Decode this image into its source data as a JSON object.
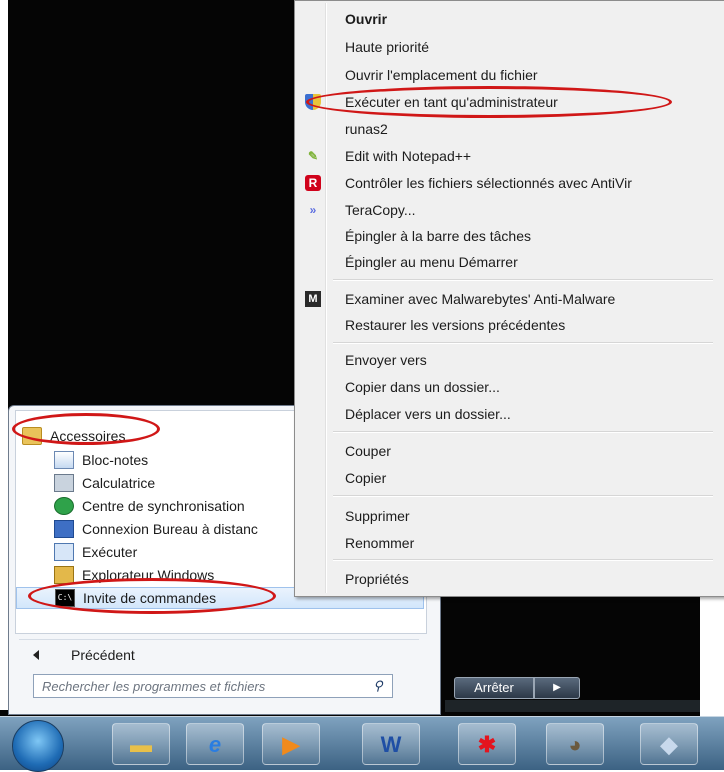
{
  "context_menu": {
    "items": [
      {
        "label": "Ouvrir",
        "bold": true,
        "icon": null
      },
      {
        "label": "Haute priorité",
        "icon": null
      },
      {
        "label": "Ouvrir l'emplacement du fichier",
        "icon": null
      },
      {
        "label": "Exécuter en tant qu'administrateur",
        "icon": "shield-icon"
      },
      {
        "label": "runas2",
        "icon": null
      },
      {
        "label": "Edit with Notepad++",
        "icon": "notepadpp-icon"
      },
      {
        "label": "Contrôler les fichiers sélectionnés avec AntiVir",
        "icon": "antivir-icon"
      },
      {
        "label": "TeraCopy...",
        "icon": "teracopy-icon"
      },
      {
        "label": "Épingler à la barre des tâches",
        "icon": null
      },
      {
        "label": "Épingler au menu Démarrer",
        "icon": null
      },
      {
        "label": "Examiner avec Malwarebytes' Anti-Malware",
        "icon": "malwarebytes-icon"
      },
      {
        "label": "Restaurer les versions précédentes",
        "icon": null
      },
      {
        "label": "Envoyer vers",
        "icon": null
      },
      {
        "label": "Copier dans un dossier...",
        "icon": null
      },
      {
        "label": "Déplacer vers un dossier...",
        "icon": null
      },
      {
        "label": "Couper",
        "icon": null
      },
      {
        "label": "Copier",
        "icon": null
      },
      {
        "label": "Supprimer",
        "icon": null
      },
      {
        "label": "Renommer",
        "icon": null
      },
      {
        "label": "Propriétés",
        "icon": null
      }
    ]
  },
  "start_menu": {
    "programs": [
      {
        "label": "Accessoires",
        "icon": "folder-icon"
      },
      {
        "label": "Bloc-notes",
        "icon": "notepad-icon"
      },
      {
        "label": "Calculatrice",
        "icon": "calculator-icon"
      },
      {
        "label": "Centre de synchronisation",
        "icon": "sync-center-icon"
      },
      {
        "label": "Connexion Bureau à distanc",
        "icon": "remote-desktop-icon"
      },
      {
        "label": "Exécuter",
        "icon": "run-icon"
      },
      {
        "label": "Explorateur Windows",
        "icon": "explorer-icon"
      },
      {
        "label": "Invite de commandes",
        "icon": "cmd-icon",
        "selected": true
      }
    ],
    "back_label": "Précédent",
    "search_placeholder": "Rechercher les programmes et fichiers",
    "shutdown_label": "Arrêter",
    "shutdown_arrow": "▶"
  },
  "taskbar": {
    "items": [
      "start-orb-icon",
      "folder-icon",
      "internet-explorer-icon",
      "media-player-icon",
      "word-icon",
      "red-splash-icon",
      "gimp-icon",
      "windows-explorer-icon"
    ]
  },
  "colors": {
    "annotation": "#d01717",
    "desktop": "#050505",
    "menu_bg": "#f0f0f0"
  }
}
